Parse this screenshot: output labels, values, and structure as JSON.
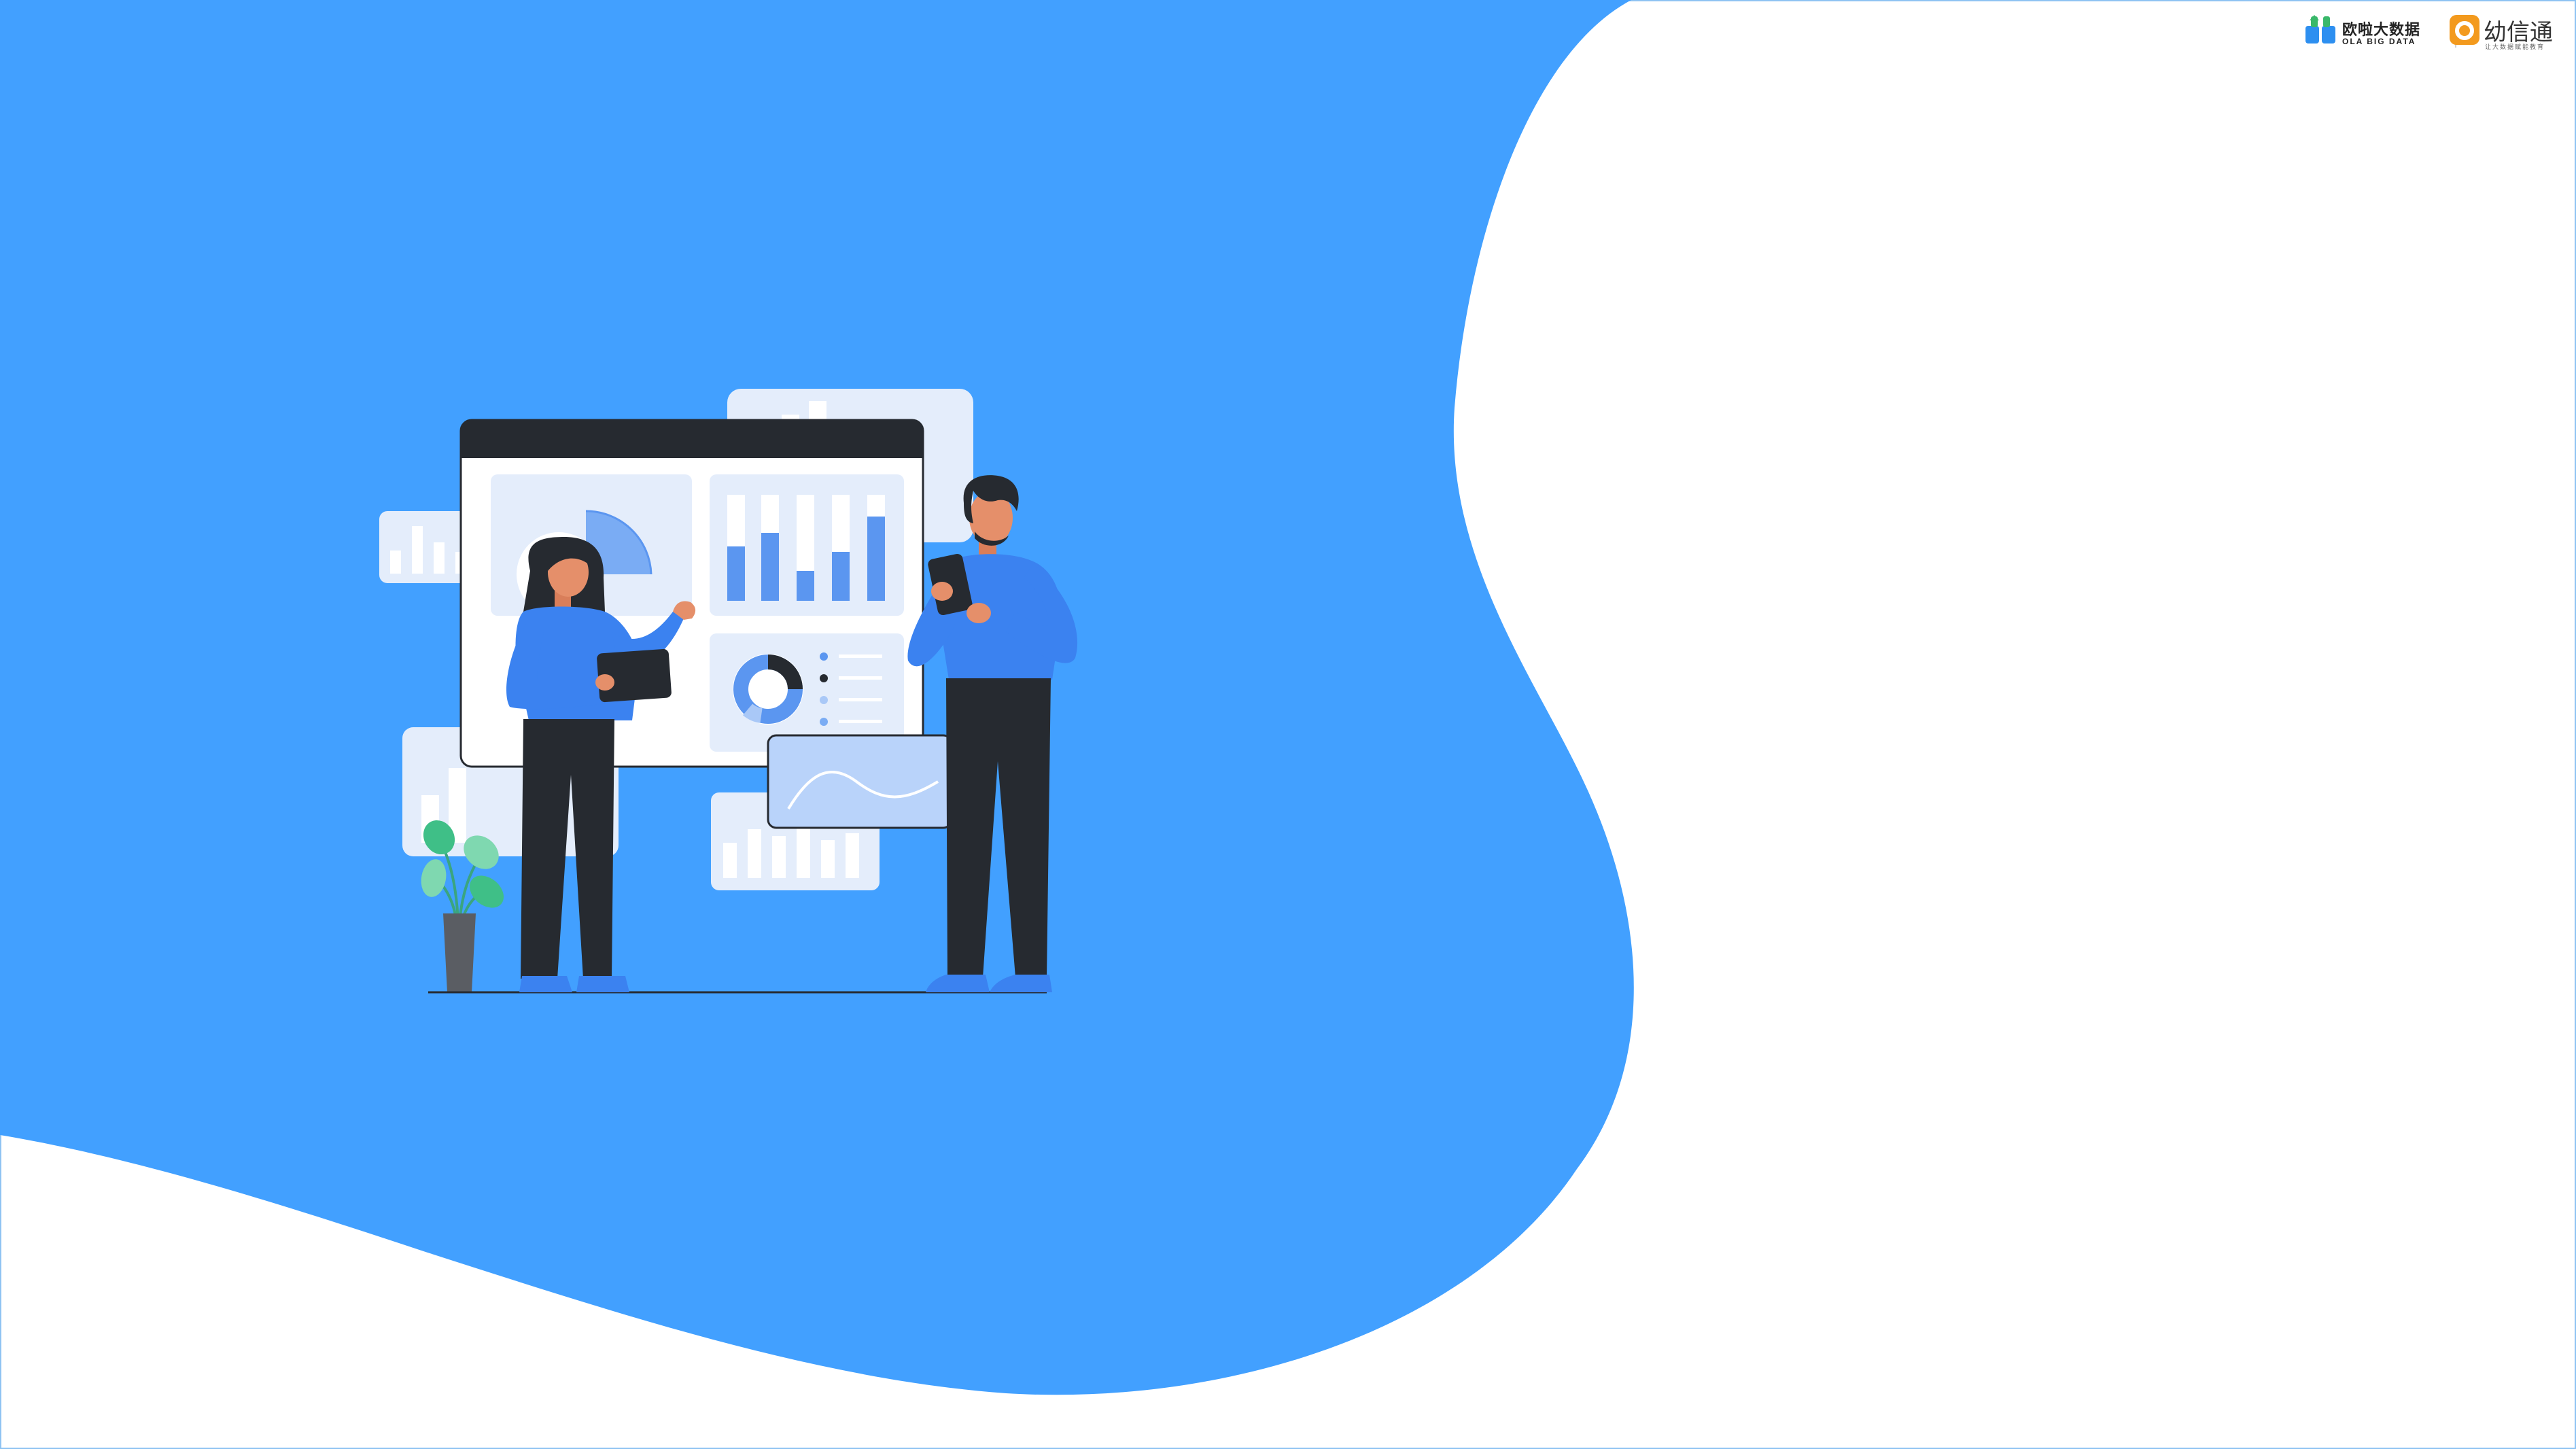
{
  "logos": {
    "ola_name": "欧啦大数据",
    "ola_en": "OLA BIG DATA",
    "yxt_name": "幼信通",
    "yxt_tagline": "让大数据赋能教育"
  },
  "colors": {
    "primary_blue": "#42a0ff",
    "figure_blue": "#3b82f0",
    "dark": "#262a30",
    "panel_light": "#e4edfb",
    "white": "#ffffff"
  },
  "illustration": {
    "description_icons": [
      "bar-chart-icon",
      "pie-chart-icon",
      "donut-chart-icon",
      "line-chart-icon",
      "plant-icon"
    ]
  }
}
